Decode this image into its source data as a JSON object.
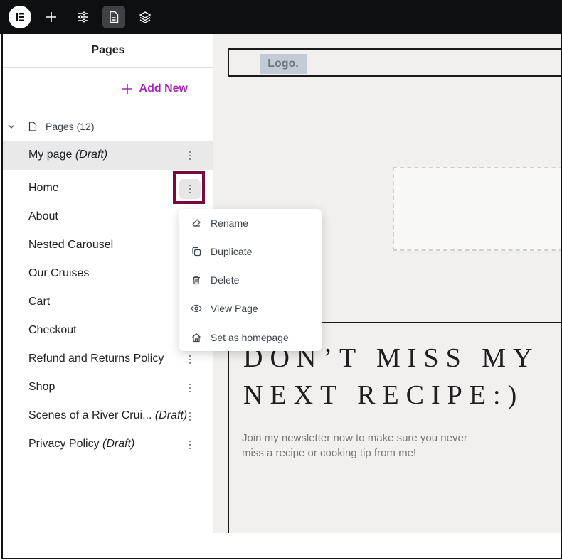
{
  "topbar": {
    "buttons": [
      {
        "name": "elementor-logo-icon"
      },
      {
        "name": "add-element-icon"
      },
      {
        "name": "site-settings-icon"
      },
      {
        "name": "pages-icon",
        "active": true
      },
      {
        "name": "structure-layers-icon"
      }
    ]
  },
  "panel": {
    "title": "Pages",
    "add_new_label": "Add New",
    "accent_color": "#a725b6",
    "group_label": "Pages (12)",
    "items": [
      {
        "title": "My page",
        "draft": "(Draft)",
        "highlighted": true
      },
      {
        "title": "Home",
        "draft": "",
        "menu_open": true
      },
      {
        "title": "About",
        "draft": ""
      },
      {
        "title": "Nested Carousel",
        "draft": ""
      },
      {
        "title": "Our Cruises",
        "draft": ""
      },
      {
        "title": "Cart",
        "draft": ""
      },
      {
        "title": "Checkout",
        "draft": ""
      },
      {
        "title": "Refund and Returns Policy",
        "draft": ""
      },
      {
        "title": "Shop",
        "draft": ""
      },
      {
        "title": "Scenes of a River Crui...",
        "draft": "(Draft)"
      },
      {
        "title": "Privacy Policy",
        "draft": "(Draft)"
      }
    ]
  },
  "context_menu": {
    "items": [
      {
        "label": "Rename",
        "icon": "eraser-icon"
      },
      {
        "label": "Duplicate",
        "icon": "copy-icon"
      },
      {
        "label": "Delete",
        "icon": "trash-icon"
      },
      {
        "label": "View Page",
        "icon": "eye-icon"
      },
      {
        "label": "Set as homepage",
        "icon": "home-icon"
      }
    ]
  },
  "canvas": {
    "logo_text": "Logo.",
    "headline_line1": "DON’T MISS MY",
    "headline_line2": "NEXT RECIPE:)",
    "subtext": "Join my newsletter now to make sure you never miss a recipe or cooking tip from me!"
  }
}
